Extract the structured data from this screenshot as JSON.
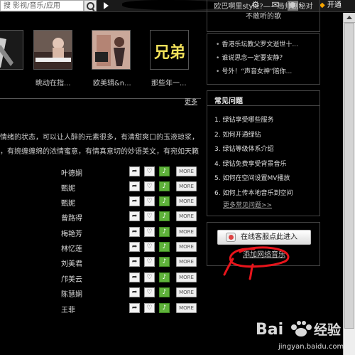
{
  "topbar": {
    "search_placeholder": "搜 影视/音乐/应用",
    "notify_badge": "",
    "ktong_label": "开通"
  },
  "thumbs": [
    {
      "caption": ""
    },
    {
      "caption": "眺动在指..."
    },
    {
      "caption": "欧美辑&n..."
    },
    {
      "caption": "那些年一..."
    }
  ],
  "thumb_art_text": "兄弟",
  "more_label": "更多",
  "description": [
    "情绪的状态，可以让人醉的元素很多，有清甜爽口的玉液琼浆，",
    "，有婉缠缠绵的浓情蜜意，有情真意切的妙语美文，有宛如天籁"
  ],
  "songs": [
    {
      "name": "叶德娴"
    },
    {
      "name": "甄妮"
    },
    {
      "name": "甄妮"
    },
    {
      "name": "曾路得"
    },
    {
      "name": "梅艳芳"
    },
    {
      "name": "林忆莲"
    },
    {
      "name": "刘美君"
    },
    {
      "name": "邝美云"
    },
    {
      "name": "陈慧娴"
    },
    {
      "name": "王菲"
    }
  ],
  "more_btn_label": "MORE",
  "news_head": [
    "欧巴啊里style?——局帅剧秘对",
    "不敢听的歌"
  ],
  "news": [
    "香港乐坛教父罗文逝世十...",
    "谁说思念一定要安静？",
    "号外！“声音女神”陪你..."
  ],
  "faq": {
    "title": "常见问题",
    "items": [
      "1. 绿钻享受哪些服务",
      "2. 如何开通绿钻",
      "3. 绿钻等级体系介绍",
      "4. 绿钻免费享受背景音乐",
      "5. 如何在空间设置MV播放",
      "6. 如何上传本地音乐到空间"
    ],
    "more": "更多常见问题>>"
  },
  "enter": {
    "button": "在线客服点此进入",
    "add_music": "添加网络音乐"
  },
  "watermark": {
    "brand": "Bai",
    "jingyan": "经验",
    "url": "jingyan.baidu.com"
  },
  "colors": {
    "add_green": "#5fb23b",
    "annotation_red": "#e8141b",
    "vip_orange": "#f7a500"
  }
}
